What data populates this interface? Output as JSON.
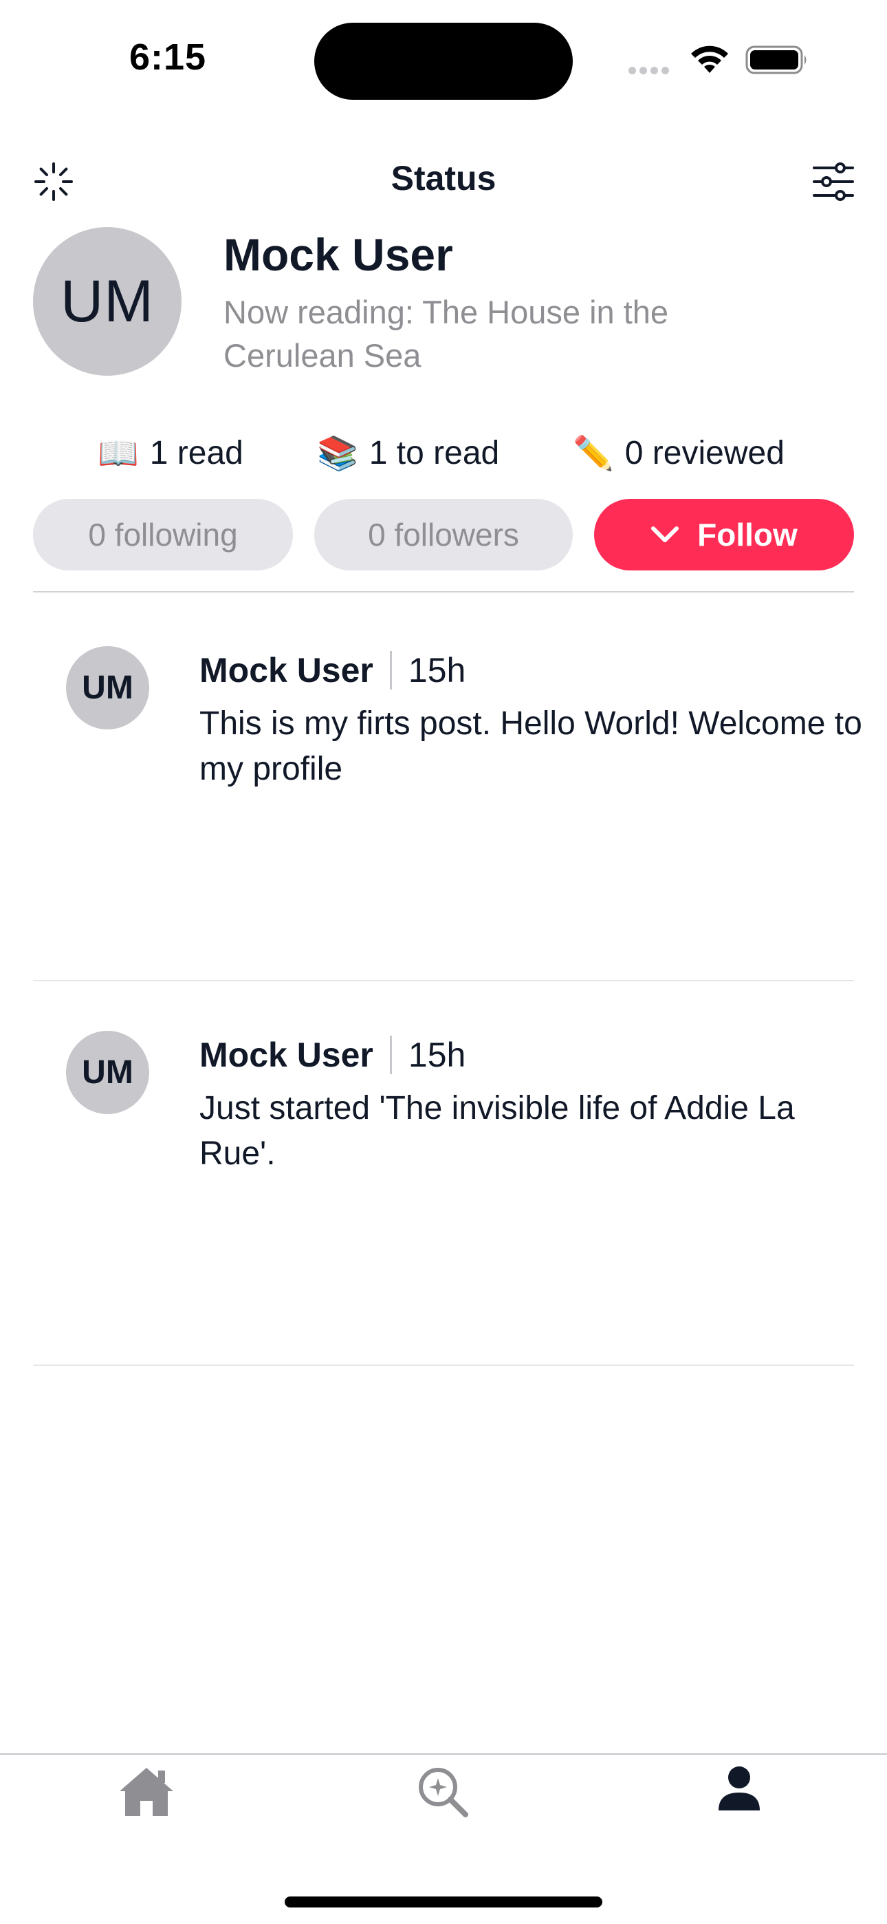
{
  "status_bar": {
    "time": "6:15"
  },
  "nav": {
    "title": "Status",
    "left_icon": "loading-spinner-icon",
    "right_icon": "sliders-icon"
  },
  "profile": {
    "initials": "UM",
    "name": "Mock User",
    "now_reading": "Now reading: The House in the Cerulean Sea"
  },
  "stats": [
    {
      "emoji": "📖",
      "label": "1 read"
    },
    {
      "emoji": "📚",
      "label": "1 to read"
    },
    {
      "emoji": "✏️",
      "label": "0 reviewed"
    }
  ],
  "social": {
    "following_label": "0 following",
    "followers_label": "0 followers",
    "follow_label": "Follow"
  },
  "posts": [
    {
      "initials": "UM",
      "author": "Mock User",
      "time": "15h",
      "text": "This is my firts post. Hello World! Welcome to my profile"
    },
    {
      "initials": "UM",
      "author": "Mock User",
      "time": "15h",
      "text": "Just started 'The invisible life of Addie La Rue'."
    }
  ],
  "tabbar": {
    "tabs": [
      {
        "icon": "home-icon",
        "active": false
      },
      {
        "icon": "discover-search-icon",
        "active": false
      },
      {
        "icon": "profile-icon",
        "active": true
      }
    ]
  },
  "colors": {
    "accent": "#ff2d55",
    "text_primary": "#111827",
    "text_secondary": "#8e8e93",
    "avatar_bg": "#c7c7cc",
    "pill_bg": "#e5e5ea",
    "tab_inactive": "#8e8e93"
  }
}
